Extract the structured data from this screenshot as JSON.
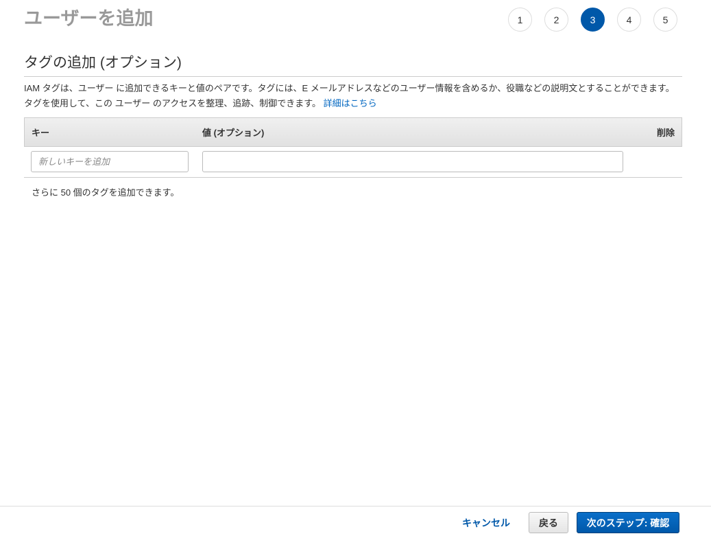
{
  "header": {
    "title": "ユーザーを追加",
    "steps": [
      "1",
      "2",
      "3",
      "4",
      "5"
    ],
    "active_step": 3
  },
  "section": {
    "title": "タグの追加 (オプション)",
    "description": "IAM タグは、ユーザー に追加できるキーと値のペアです。タグには、E メールアドレスなどのユーザー情報を含めるか、役職などの説明文とすることができます。タグを使用して、この ユーザー のアクセスを整理、追跡、制御できます。",
    "learn_more": "詳細はこちら"
  },
  "table": {
    "columns": {
      "key": "キー",
      "value": "値 (オプション)",
      "delete": "削除"
    },
    "key_placeholder": "新しいキーを追加",
    "key_value": "",
    "value_value": ""
  },
  "remaining": "さらに 50 個のタグを追加できます。",
  "footer": {
    "cancel": "キャンセル",
    "back": "戻る",
    "next": "次のステップ: 確認"
  }
}
